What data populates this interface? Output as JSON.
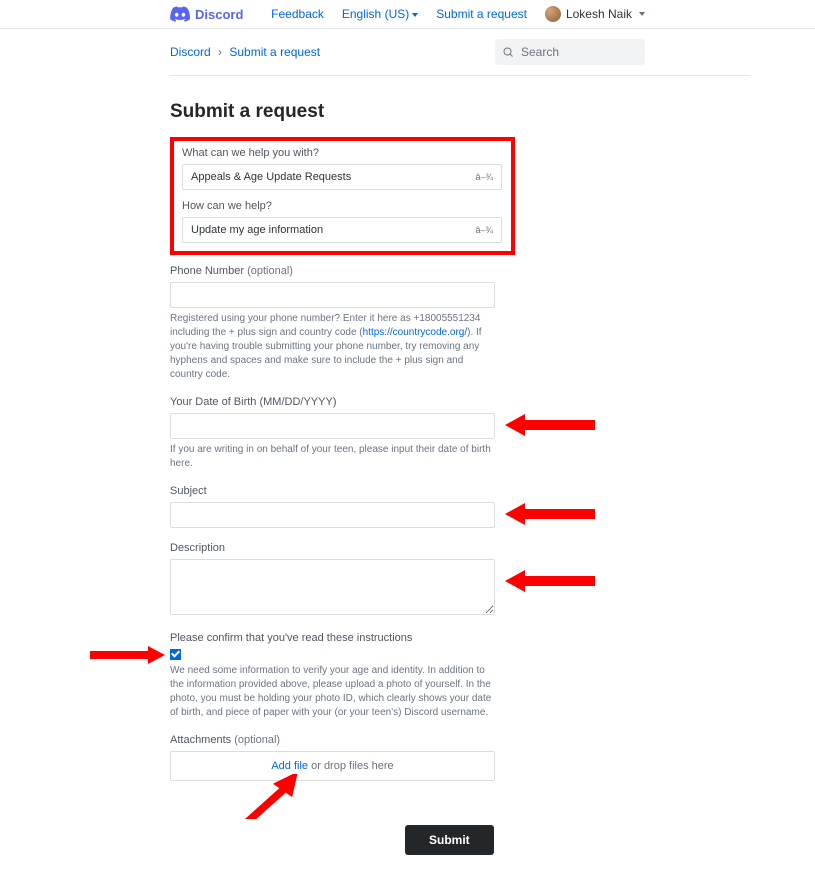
{
  "header": {
    "logo_text": "Discord",
    "links": {
      "feedback": "Feedback",
      "language": "English (US)",
      "submit": "Submit a request"
    },
    "user_name": "Lokesh Naik"
  },
  "breadcrumb": {
    "root": "Discord",
    "current": "Submit a request"
  },
  "search": {
    "placeholder": "Search"
  },
  "page": {
    "title": "Submit a request"
  },
  "form": {
    "help_with": {
      "label": "What can we help you with?",
      "value": "Appeals & Age Update Requests",
      "chevron": "â–¾"
    },
    "how_help": {
      "label": "How can we help?",
      "value": "Update my age information",
      "chevron": "â–¾"
    },
    "phone": {
      "label": "Phone Number",
      "optional": "(optional)",
      "hint_1": "Registered using your phone number? Enter it here as +18005551234 including the + plus sign and country code (",
      "hint_link": "https://countrycode.org/",
      "hint_2": "). If you're having trouble submitting your phone number, try removing any hyphens and spaces and make sure to include the + plus sign and country code."
    },
    "dob": {
      "label": "Your Date of Birth (MM/DD/YYYY)",
      "hint": "If you are writing in on behalf of your teen, please input their date of birth here."
    },
    "subject": {
      "label": "Subject"
    },
    "description": {
      "label": "Description"
    },
    "confirm": {
      "label": "Please confirm that you've read these instructions",
      "hint": "We need some information to verify your age and identity. In addition to the information provided above, please upload a photo of yourself. In the photo, you must be holding your photo ID, which clearly shows your date of birth, and piece of paper with your (or your teen's) Discord username."
    },
    "attachments": {
      "label": "Attachments",
      "optional": "(optional)",
      "add_file": "Add file",
      "drop_text": " or drop files here"
    },
    "submit_button": "Submit"
  }
}
